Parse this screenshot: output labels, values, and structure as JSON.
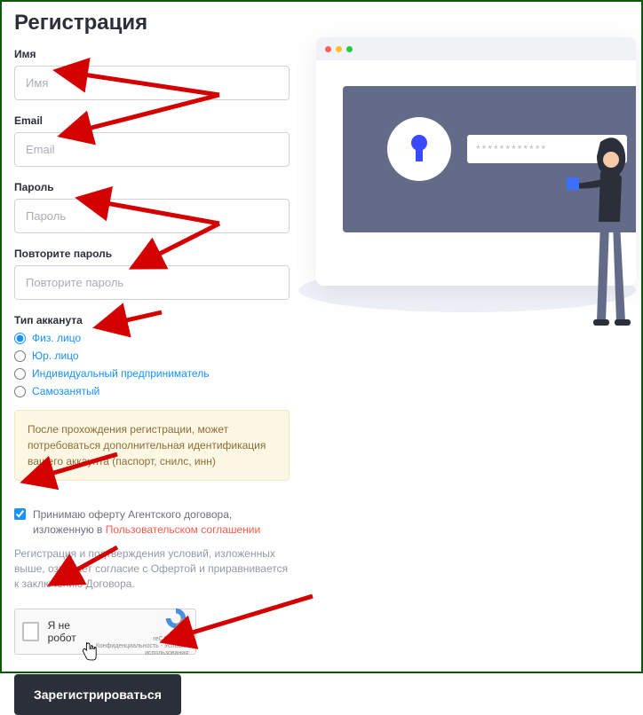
{
  "title": "Регистрация",
  "fields": {
    "name": {
      "label": "Имя",
      "placeholder": "Имя"
    },
    "email": {
      "label": "Email",
      "placeholder": "Email"
    },
    "pass": {
      "label": "Пароль",
      "placeholder": "Пароль"
    },
    "pass2": {
      "label": "Повторите пароль",
      "placeholder": "Повторите пароль"
    }
  },
  "account_type": {
    "label": "Тип акканута",
    "options": [
      {
        "label": "Физ. лицо",
        "checked": true
      },
      {
        "label": "Юр. лицо",
        "checked": false
      },
      {
        "label": "Индивидуальный предприниматель",
        "checked": false
      },
      {
        "label": "Самозанятый",
        "checked": false
      }
    ]
  },
  "notice": "После прохождения регистрации, может потребоваться дополнительная идентификация вашего аккаунта (паспорт, снилс, инн)",
  "agree": {
    "text": "Принимаю оферту Агентского договора, изложенную в ",
    "link_text": "Пользовательском соглашении",
    "checked": true
  },
  "legal_note": "Регистрация и подтверждения условий, изложенных выше, означает согласие с Офертой и приравнивается к заключению Договора.",
  "captcha": {
    "label": "Я не робот",
    "brand": "reCAPTCHA",
    "sub": "Конфиденциальность - Условия использования"
  },
  "submit_label": "Зарегистрироваться",
  "illustration": {
    "password_mask": "************"
  }
}
